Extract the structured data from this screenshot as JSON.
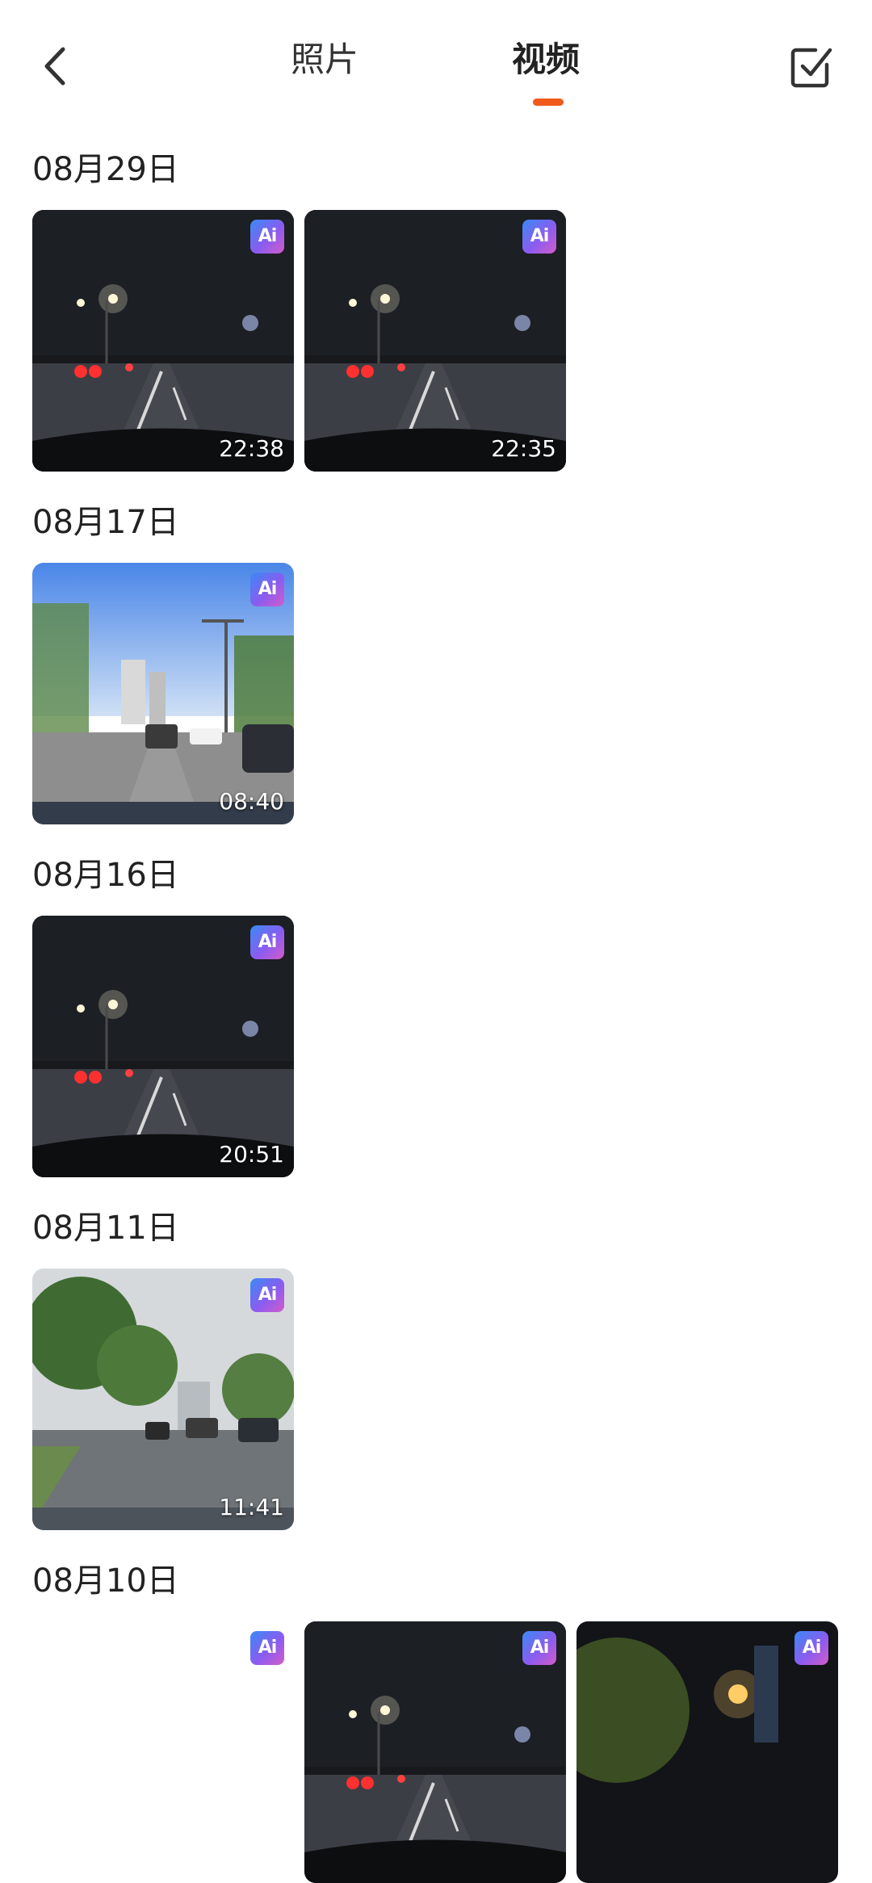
{
  "header": {
    "tabs": [
      {
        "label": "照片",
        "active": false
      },
      {
        "label": "视频",
        "active": true
      }
    ],
    "accent_color": "#f05a1a",
    "icons": {
      "back": "chevron-left-icon",
      "select": "checkbox-check-icon"
    }
  },
  "groups": [
    {
      "date": "08月29日",
      "videos": [
        {
          "duration": "22:38",
          "badge": "Ai",
          "scene": "night"
        },
        {
          "duration": "22:35",
          "badge": "Ai",
          "scene": "night"
        }
      ]
    },
    {
      "date": "08月17日",
      "videos": [
        {
          "duration": "08:40",
          "badge": "Ai",
          "scene": "day"
        }
      ]
    },
    {
      "date": "08月16日",
      "videos": [
        {
          "duration": "20:51",
          "badge": "Ai",
          "scene": "night"
        }
      ]
    },
    {
      "date": "08月11日",
      "videos": [
        {
          "duration": "11:41",
          "badge": "Ai",
          "scene": "overcast"
        }
      ]
    },
    {
      "date": "08月10日",
      "videos": [
        {
          "duration": "",
          "badge": "Ai",
          "scene": "blank"
        },
        {
          "duration": "",
          "badge": "Ai",
          "scene": "night"
        },
        {
          "duration": "",
          "badge": "Ai",
          "scene": "night-trees"
        }
      ]
    }
  ]
}
